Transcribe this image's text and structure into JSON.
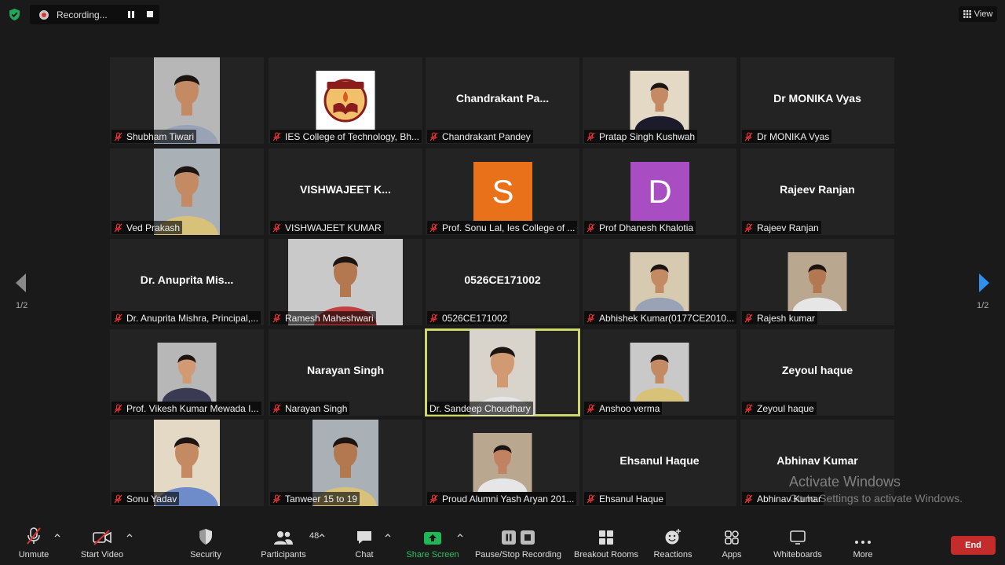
{
  "header": {
    "recording_label": "Recording...",
    "view_label": "View"
  },
  "pager": {
    "left": "1/2",
    "right": "1/2"
  },
  "watermark": {
    "title": "Activate Windows",
    "subtitle": "Go to Settings to activate Windows."
  },
  "tiles": [
    {
      "name": "Shubham Tiwari",
      "display": "photo"
    },
    {
      "name": "IES College of Technology, Bh...",
      "display": "logo"
    },
    {
      "name": "Chandrakant Pandey",
      "display": "name",
      "big": "Chandrakant  Pa..."
    },
    {
      "name": "Pratap Singh Kushwah",
      "display": "photo-sq"
    },
    {
      "name": "Dr MONIKA Vyas",
      "display": "name",
      "big": "Dr MONIKA Vyas"
    },
    {
      "name": "Ved Prakash",
      "display": "photo"
    },
    {
      "name": "VISHWAJEET KUMAR",
      "display": "name",
      "big": "VISHWAJEET  K..."
    },
    {
      "name": "Prof. Sonu Lal, Ies College of ...",
      "display": "letter",
      "letter": "S",
      "color": "#e8711a"
    },
    {
      "name": "Prof Dhanesh Khalotia",
      "display": "letter",
      "letter": "D",
      "color": "#a94dc2"
    },
    {
      "name": "Rajeev Ranjan",
      "display": "name",
      "big": "Rajeev Ranjan"
    },
    {
      "name": "Dr. Anuprita Mishra, Principal,...",
      "display": "name",
      "big": "Dr. Anuprita  Mis..."
    },
    {
      "name": "Ramesh Maheshwari",
      "display": "photo-wide"
    },
    {
      "name": "0526CE171002",
      "display": "name",
      "big": "0526CE171002"
    },
    {
      "name": "Abhishek Kumar(0177CE2010...",
      "display": "photo-sq"
    },
    {
      "name": "Rajesh kumar",
      "display": "photo-sq"
    },
    {
      "name": "Prof. Vikesh Kumar Mewada I...",
      "display": "photo-sq"
    },
    {
      "name": "Narayan Singh",
      "display": "name",
      "big": "Narayan Singh"
    },
    {
      "name": "Dr. Sandeep Choudhary",
      "display": "photo",
      "active": true,
      "muted": false
    },
    {
      "name": "Anshoo verma",
      "display": "photo-sq"
    },
    {
      "name": "Zeyoul haque",
      "display": "name",
      "big": "Zeyoul haque"
    },
    {
      "name": "Sonu Yadav",
      "display": "photo"
    },
    {
      "name": "Tanweer 15 to 19",
      "display": "photo"
    },
    {
      "name": "Proud Alumni Yash Aryan 201...",
      "display": "photo-sq"
    },
    {
      "name": "Ehsanul Haque",
      "display": "name",
      "big": "Ehsanul Haque"
    },
    {
      "name": "Abhinav Kumar",
      "display": "name",
      "big": "Abhinav Kumar"
    }
  ],
  "toolbar": {
    "unmute": "Unmute",
    "start_video": "Start Video",
    "security": "Security",
    "participants": "Participants",
    "participants_count": "48",
    "chat": "Chat",
    "share_screen": "Share Screen",
    "pause_recording": "Pause/Stop Recording",
    "breakout": "Breakout Rooms",
    "reactions": "Reactions",
    "apps": "Apps",
    "whiteboards": "Whiteboards",
    "more": "More",
    "end": "End"
  },
  "colors": {
    "accent_green": "#1db954",
    "end_red": "#c42b2b",
    "active_border": "#ccd86a",
    "arrow_blue": "#2e8ff0"
  }
}
